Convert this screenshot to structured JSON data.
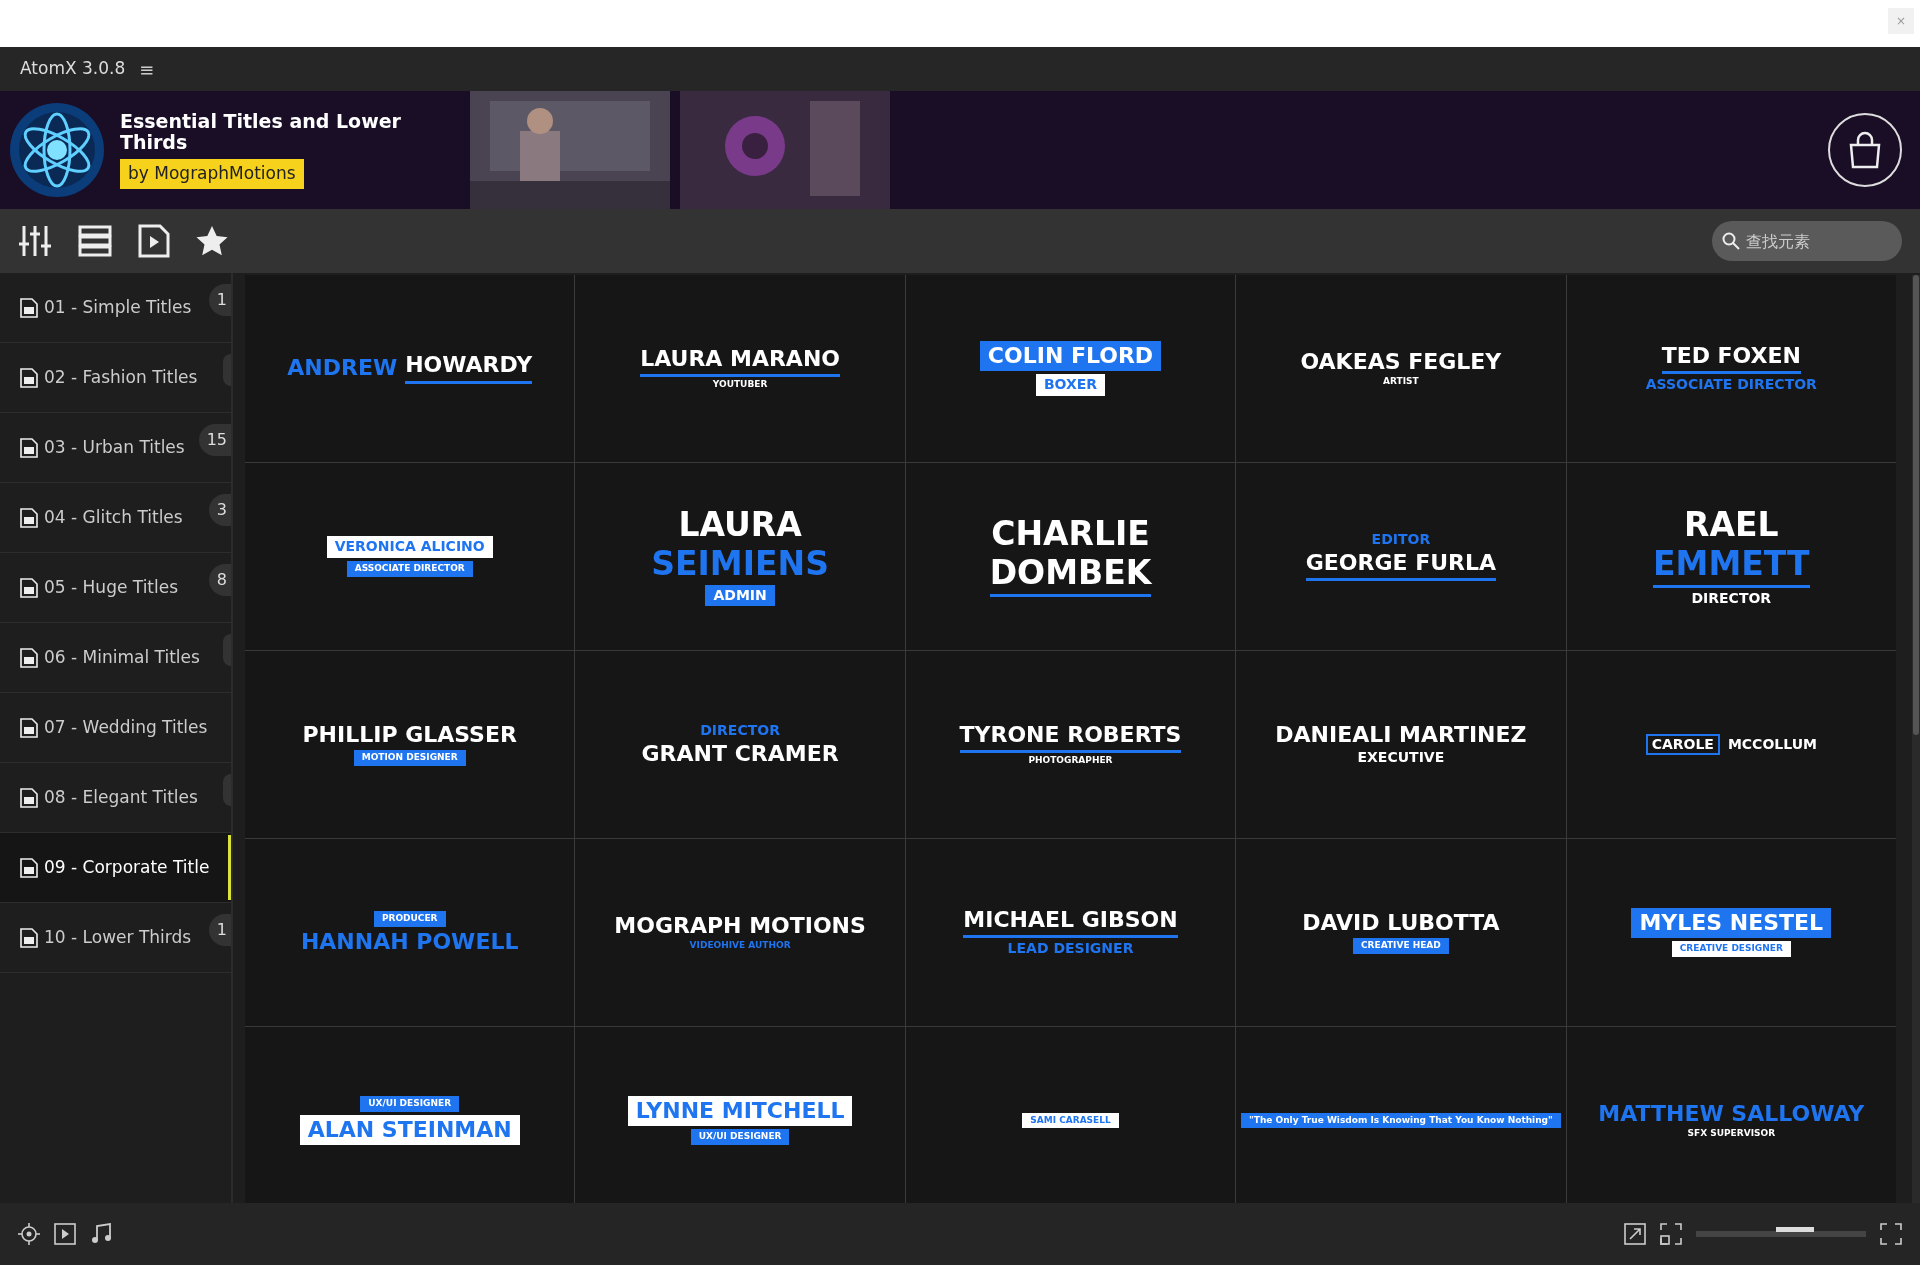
{
  "window": {
    "close": "×"
  },
  "app": {
    "title": "AtomX 3.0.8",
    "menu": "≡"
  },
  "banner": {
    "title": "Essential Titles and Lower Thirds",
    "by": "by",
    "author": "MographMotions"
  },
  "search": {
    "placeholder": "查找元素"
  },
  "sidebar": {
    "items": [
      {
        "label": "01 - Simple Titles",
        "count": "1",
        "selected": false
      },
      {
        "label": "02 - Fashion Titles",
        "badge": true,
        "selected": false
      },
      {
        "label": "03 - Urban Titles",
        "count": "15",
        "selected": false
      },
      {
        "label": "04 - Glitch Titles",
        "count": "3",
        "selected": false
      },
      {
        "label": "05 - Huge Titles",
        "count": "8",
        "selected": false
      },
      {
        "label": "06 - Minimal Titles",
        "badge": true,
        "selected": false
      },
      {
        "label": "07 - Wedding Titles",
        "selected": false
      },
      {
        "label": "08 - Elegant Titles",
        "badge": true,
        "selected": false
      },
      {
        "label": "09 - Corporate Title",
        "selected": true
      },
      {
        "label": "10 - Lower Thirds",
        "count": "1",
        "selected": false
      }
    ]
  },
  "tiles": [
    {
      "lines": [
        [
          {
            "text": "ANDREW",
            "color": "#1f74f0",
            "kind": "name"
          },
          {
            "text": "HOWARDY",
            "color": "#ffffff",
            "kind": "name_under"
          }
        ]
      ]
    },
    {
      "lines": [
        [
          {
            "text": "LAURA MARANO",
            "color": "#ffffff",
            "kind": "name_under"
          }
        ],
        [
          {
            "text": "YOUTUBER",
            "color": "#ffffff",
            "kind": "tiny"
          }
        ]
      ]
    },
    {
      "lines": [
        [
          {
            "text": "COLIN FLORD",
            "color": "#1f74f0",
            "kind": "name_boxed"
          }
        ],
        [
          {
            "text": "BOXER",
            "color": "#ffffff",
            "kind": "small_boxed"
          }
        ]
      ]
    },
    {
      "lines": [
        [
          {
            "text": "OAKEAS FEGLEY",
            "color": "#ffffff",
            "kind": "name"
          }
        ],
        [
          {
            "text": "ARTIST",
            "color": "#ffffff",
            "kind": "tiny"
          }
        ]
      ]
    },
    {
      "lines": [
        [
          {
            "text": "TED FOXEN",
            "color": "#ffffff",
            "kind": "name_under"
          }
        ],
        [
          {
            "text": "ASSOCIATE DIRECTOR",
            "color": "#1f74f0",
            "kind": "small"
          }
        ]
      ]
    },
    {
      "lines": [
        [
          {
            "text": "VERONICA ALICINO",
            "color": "#ffffff",
            "kind": "small_boxed"
          }
        ],
        [
          {
            "text": "ASSOCIATE DIRECTOR",
            "color": "#1f74f0",
            "kind": "tiny_boxed"
          }
        ]
      ]
    },
    {
      "lines": [
        [
          {
            "text": "LAURA",
            "color": "#ffffff",
            "kind": "big"
          }
        ],
        [
          {
            "text": "SEIMIENS",
            "color": "#1f74f0",
            "kind": "big"
          }
        ],
        [
          {
            "text": "ADMIN",
            "color": "#1f74f0",
            "kind": "small_boxed"
          }
        ]
      ]
    },
    {
      "lines": [
        [
          {
            "text": "CHARLIE",
            "color": "#ffffff",
            "kind": "big"
          }
        ],
        [
          {
            "text": "DOMBEK",
            "color": "#ffffff",
            "kind": "big_under"
          }
        ]
      ]
    },
    {
      "lines": [
        [
          {
            "text": "EDITOR",
            "color": "#1f74f0",
            "kind": "small"
          }
        ],
        [
          {
            "text": "GEORGE FURLA",
            "color": "#ffffff",
            "kind": "name_under"
          }
        ]
      ]
    },
    {
      "lines": [
        [
          {
            "text": "RAEL",
            "color": "#ffffff",
            "kind": "big"
          }
        ],
        [
          {
            "text": "EMMETT",
            "color": "#1f74f0",
            "kind": "big_under"
          }
        ],
        [
          {
            "text": "DIRECTOR",
            "color": "#ffffff",
            "kind": "small"
          }
        ]
      ]
    },
    {
      "lines": [
        [
          {
            "text": "PHILLIP GLASSER",
            "color": "#ffffff",
            "kind": "name"
          }
        ],
        [
          {
            "text": "MOTION DESIGNER",
            "color": "#1f74f0",
            "kind": "tiny_boxed"
          }
        ]
      ]
    },
    {
      "lines": [
        [
          {
            "text": "DIRECTOR",
            "color": "#1f74f0",
            "kind": "small"
          }
        ],
        [
          {
            "text": "GRANT CRAMER",
            "color": "#ffffff",
            "kind": "name"
          }
        ]
      ]
    },
    {
      "lines": [
        [
          {
            "text": "TYRONE ROBERTS",
            "color": "#ffffff",
            "kind": "name_under"
          }
        ],
        [
          {
            "text": "PHOTOGRAPHER",
            "color": "#ffffff",
            "kind": "tiny"
          }
        ]
      ]
    },
    {
      "lines": [
        [
          {
            "text": "DANIEALI MARTINEZ",
            "color": "#ffffff",
            "kind": "name"
          }
        ],
        [
          {
            "text": "EXECUTIVE",
            "color": "#ffffff",
            "kind": "small"
          }
        ]
      ]
    },
    {
      "lines": [
        [
          {
            "text": "CAROLE",
            "color": "#ffffff",
            "kind": "small_outline"
          },
          {
            "text": "MCCOLLUM",
            "color": "#ffffff",
            "kind": "small"
          }
        ]
      ]
    },
    {
      "lines": [
        [
          {
            "text": "PRODUCER",
            "color": "#1f74f0",
            "kind": "tiny_boxed"
          }
        ],
        [
          {
            "text": "HANNAH POWELL",
            "color": "#1f74f0",
            "kind": "name"
          }
        ]
      ]
    },
    {
      "lines": [
        [
          {
            "text": "MOGRAPH MOTIONS",
            "color": "#ffffff",
            "kind": "name"
          }
        ],
        [
          {
            "text": "VIDEOHIVE AUTHOR",
            "color": "#1f74f0",
            "kind": "tiny"
          }
        ]
      ]
    },
    {
      "lines": [
        [
          {
            "text": "MICHAEL GIBSON",
            "color": "#ffffff",
            "kind": "name_under"
          }
        ],
        [
          {
            "text": "LEAD DESIGNER",
            "color": "#1f74f0",
            "kind": "small"
          }
        ]
      ]
    },
    {
      "lines": [
        [
          {
            "text": "DAVID LUBOTTA",
            "color": "#ffffff",
            "kind": "name"
          }
        ],
        [
          {
            "text": "CREATIVE HEAD",
            "color": "#1f74f0",
            "kind": "tiny_boxed"
          }
        ]
      ]
    },
    {
      "lines": [
        [
          {
            "text": "MYLES NESTEL",
            "color": "#1f74f0",
            "kind": "name_boxed"
          }
        ],
        [
          {
            "text": "CREATIVE DESIGNER",
            "color": "#ffffff",
            "kind": "tiny_boxed"
          }
        ]
      ]
    },
    {
      "lines": [
        [
          {
            "text": "UX/UI DESIGNER",
            "color": "#1f74f0",
            "kind": "tiny_boxed"
          }
        ],
        [
          {
            "text": "ALAN STEINMAN",
            "color": "#ffffff",
            "kind": "name_boxed"
          }
        ]
      ]
    },
    {
      "lines": [
        [
          {
            "text": "LYNNE MITCHELL",
            "color": "#ffffff",
            "kind": "name_boxed"
          }
        ],
        [
          {
            "text": "UX/UI DESIGNER",
            "color": "#1f74f0",
            "kind": "tiny_boxed"
          }
        ]
      ]
    },
    {
      "lines": [
        [
          {
            "text": "SAMI CARASELL",
            "color": "#ffffff",
            "kind": "tiny_boxed"
          }
        ]
      ]
    },
    {
      "lines": [
        [
          {
            "text": "\"The Only True Wisdom Is Knowing That You Know Nothing\"",
            "color": "#1f74f0",
            "kind": "tiny_boxed"
          }
        ]
      ]
    },
    {
      "lines": [
        [
          {
            "text": "MATTHEW SALLOWAY",
            "color": "#1f74f0",
            "kind": "name"
          }
        ],
        [
          {
            "text": "SFX SUPERVISOR",
            "color": "#ffffff",
            "kind": "tiny"
          }
        ]
      ]
    }
  ],
  "zoom": {
    "level": 0.58
  }
}
